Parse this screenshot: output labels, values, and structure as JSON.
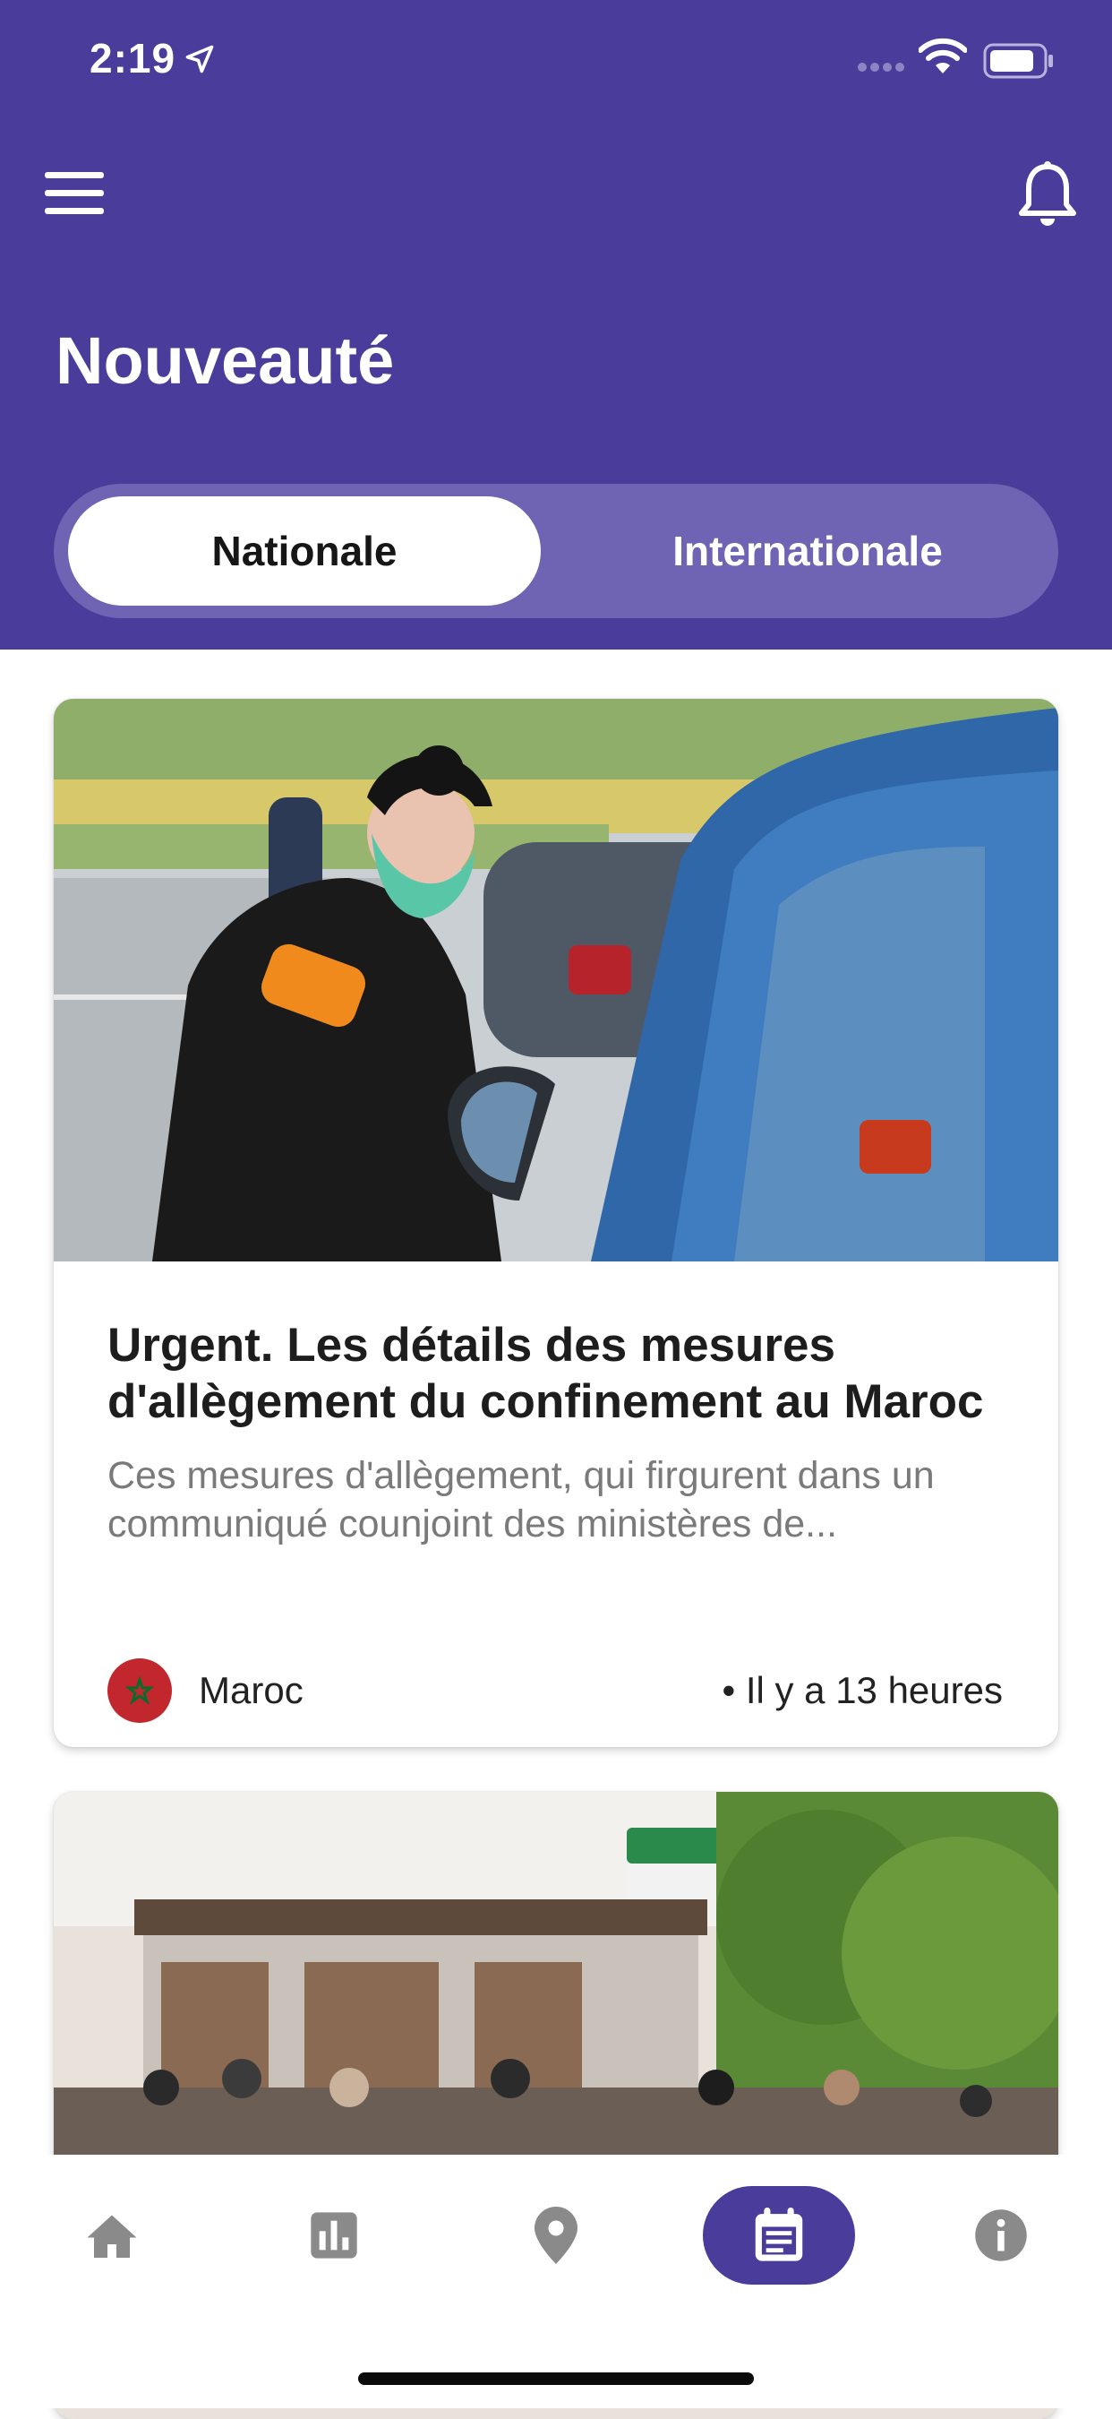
{
  "status_bar": {
    "time": "2:19"
  },
  "header": {
    "title": "Nouveauté",
    "tabs": [
      {
        "label": "Nationale",
        "active": true
      },
      {
        "label": "Internationale",
        "active": false
      }
    ]
  },
  "articles": [
    {
      "title": "Urgent. Les détails des mesures d'allègement du confinement au Maroc",
      "excerpt": "Ces mesures d'allègement, qui firgurent dans un communiqué counjoint des ministères de...",
      "source": "Maroc",
      "time": "• Il y a 13 heures",
      "image": "police-officer-at-car-window-photo"
    },
    {
      "image": "street-crowd-masks-photo"
    }
  ],
  "tabbar": {
    "items": [
      {
        "icon": "home-icon",
        "active": false
      },
      {
        "icon": "bar-chart-icon",
        "active": false
      },
      {
        "icon": "location-pin-icon",
        "active": false
      },
      {
        "icon": "calendar-news-icon",
        "active": true
      },
      {
        "icon": "info-icon",
        "active": false
      }
    ]
  },
  "colors": {
    "primary": "#4a3c9b",
    "segment_bg": "#6f63b4",
    "icon_gray": "#8a8a8a"
  }
}
